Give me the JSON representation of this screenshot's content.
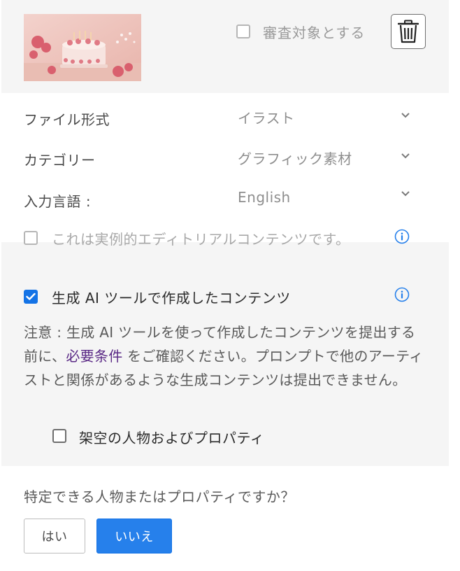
{
  "asset": {
    "review_label": "審査対象とする"
  },
  "fields": [
    {
      "label": "ファイル形式",
      "value": "イラスト"
    },
    {
      "label": "カテゴリー",
      "value": "グラフィック素材"
    },
    {
      "label": "入力言語 :",
      "value": "English"
    }
  ],
  "editorial": {
    "label": "これは実例的エディトリアルコンテンツです。",
    "checked": false
  },
  "gen_ai": {
    "label": "生成 AI ツールで作成したコンテンツ",
    "checked": true,
    "notice_before": "注意 : 生成 AI ツールを使って作成したコンテンツを提出する前に、",
    "notice_link": "必要条件",
    "notice_after": " をご確認ください。プロンプトで他のアーティストと関係があるような生成コンテンツは提出できません。"
  },
  "fictional": {
    "label": "架空の人物およびプロパティ",
    "checked": false
  },
  "identifiable": {
    "question": "特定できる人物またはプロパティですか？",
    "yes_label": "はい",
    "no_label": "いいえ",
    "selected": "いいえ"
  },
  "colors": {
    "accent": "#2680eb",
    "link": "#5b2a86",
    "panel": "#f5f5f5"
  }
}
